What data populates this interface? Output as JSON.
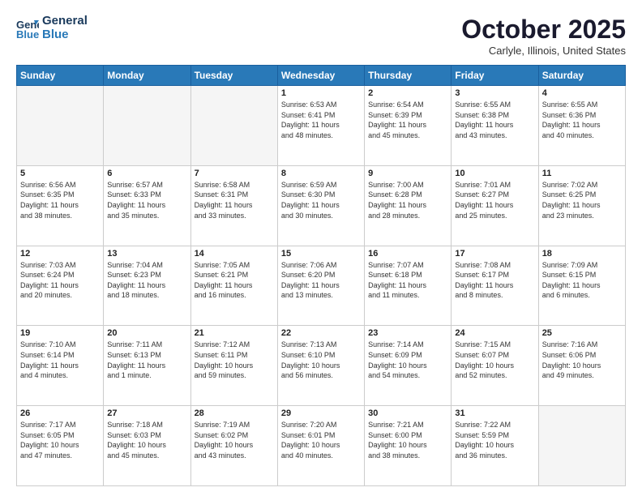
{
  "header": {
    "logo_line1": "General",
    "logo_line2": "Blue",
    "month_title": "October 2025",
    "location": "Carlyle, Illinois, United States"
  },
  "days_of_week": [
    "Sunday",
    "Monday",
    "Tuesday",
    "Wednesday",
    "Thursday",
    "Friday",
    "Saturday"
  ],
  "weeks": [
    [
      {
        "day": "",
        "info": ""
      },
      {
        "day": "",
        "info": ""
      },
      {
        "day": "",
        "info": ""
      },
      {
        "day": "1",
        "info": "Sunrise: 6:53 AM\nSunset: 6:41 PM\nDaylight: 11 hours\nand 48 minutes."
      },
      {
        "day": "2",
        "info": "Sunrise: 6:54 AM\nSunset: 6:39 PM\nDaylight: 11 hours\nand 45 minutes."
      },
      {
        "day": "3",
        "info": "Sunrise: 6:55 AM\nSunset: 6:38 PM\nDaylight: 11 hours\nand 43 minutes."
      },
      {
        "day": "4",
        "info": "Sunrise: 6:55 AM\nSunset: 6:36 PM\nDaylight: 11 hours\nand 40 minutes."
      }
    ],
    [
      {
        "day": "5",
        "info": "Sunrise: 6:56 AM\nSunset: 6:35 PM\nDaylight: 11 hours\nand 38 minutes."
      },
      {
        "day": "6",
        "info": "Sunrise: 6:57 AM\nSunset: 6:33 PM\nDaylight: 11 hours\nand 35 minutes."
      },
      {
        "day": "7",
        "info": "Sunrise: 6:58 AM\nSunset: 6:31 PM\nDaylight: 11 hours\nand 33 minutes."
      },
      {
        "day": "8",
        "info": "Sunrise: 6:59 AM\nSunset: 6:30 PM\nDaylight: 11 hours\nand 30 minutes."
      },
      {
        "day": "9",
        "info": "Sunrise: 7:00 AM\nSunset: 6:28 PM\nDaylight: 11 hours\nand 28 minutes."
      },
      {
        "day": "10",
        "info": "Sunrise: 7:01 AM\nSunset: 6:27 PM\nDaylight: 11 hours\nand 25 minutes."
      },
      {
        "day": "11",
        "info": "Sunrise: 7:02 AM\nSunset: 6:25 PM\nDaylight: 11 hours\nand 23 minutes."
      }
    ],
    [
      {
        "day": "12",
        "info": "Sunrise: 7:03 AM\nSunset: 6:24 PM\nDaylight: 11 hours\nand 20 minutes."
      },
      {
        "day": "13",
        "info": "Sunrise: 7:04 AM\nSunset: 6:23 PM\nDaylight: 11 hours\nand 18 minutes."
      },
      {
        "day": "14",
        "info": "Sunrise: 7:05 AM\nSunset: 6:21 PM\nDaylight: 11 hours\nand 16 minutes."
      },
      {
        "day": "15",
        "info": "Sunrise: 7:06 AM\nSunset: 6:20 PM\nDaylight: 11 hours\nand 13 minutes."
      },
      {
        "day": "16",
        "info": "Sunrise: 7:07 AM\nSunset: 6:18 PM\nDaylight: 11 hours\nand 11 minutes."
      },
      {
        "day": "17",
        "info": "Sunrise: 7:08 AM\nSunset: 6:17 PM\nDaylight: 11 hours\nand 8 minutes."
      },
      {
        "day": "18",
        "info": "Sunrise: 7:09 AM\nSunset: 6:15 PM\nDaylight: 11 hours\nand 6 minutes."
      }
    ],
    [
      {
        "day": "19",
        "info": "Sunrise: 7:10 AM\nSunset: 6:14 PM\nDaylight: 11 hours\nand 4 minutes."
      },
      {
        "day": "20",
        "info": "Sunrise: 7:11 AM\nSunset: 6:13 PM\nDaylight: 11 hours\nand 1 minute."
      },
      {
        "day": "21",
        "info": "Sunrise: 7:12 AM\nSunset: 6:11 PM\nDaylight: 10 hours\nand 59 minutes."
      },
      {
        "day": "22",
        "info": "Sunrise: 7:13 AM\nSunset: 6:10 PM\nDaylight: 10 hours\nand 56 minutes."
      },
      {
        "day": "23",
        "info": "Sunrise: 7:14 AM\nSunset: 6:09 PM\nDaylight: 10 hours\nand 54 minutes."
      },
      {
        "day": "24",
        "info": "Sunrise: 7:15 AM\nSunset: 6:07 PM\nDaylight: 10 hours\nand 52 minutes."
      },
      {
        "day": "25",
        "info": "Sunrise: 7:16 AM\nSunset: 6:06 PM\nDaylight: 10 hours\nand 49 minutes."
      }
    ],
    [
      {
        "day": "26",
        "info": "Sunrise: 7:17 AM\nSunset: 6:05 PM\nDaylight: 10 hours\nand 47 minutes."
      },
      {
        "day": "27",
        "info": "Sunrise: 7:18 AM\nSunset: 6:03 PM\nDaylight: 10 hours\nand 45 minutes."
      },
      {
        "day": "28",
        "info": "Sunrise: 7:19 AM\nSunset: 6:02 PM\nDaylight: 10 hours\nand 43 minutes."
      },
      {
        "day": "29",
        "info": "Sunrise: 7:20 AM\nSunset: 6:01 PM\nDaylight: 10 hours\nand 40 minutes."
      },
      {
        "day": "30",
        "info": "Sunrise: 7:21 AM\nSunset: 6:00 PM\nDaylight: 10 hours\nand 38 minutes."
      },
      {
        "day": "31",
        "info": "Sunrise: 7:22 AM\nSunset: 5:59 PM\nDaylight: 10 hours\nand 36 minutes."
      },
      {
        "day": "",
        "info": ""
      }
    ]
  ]
}
